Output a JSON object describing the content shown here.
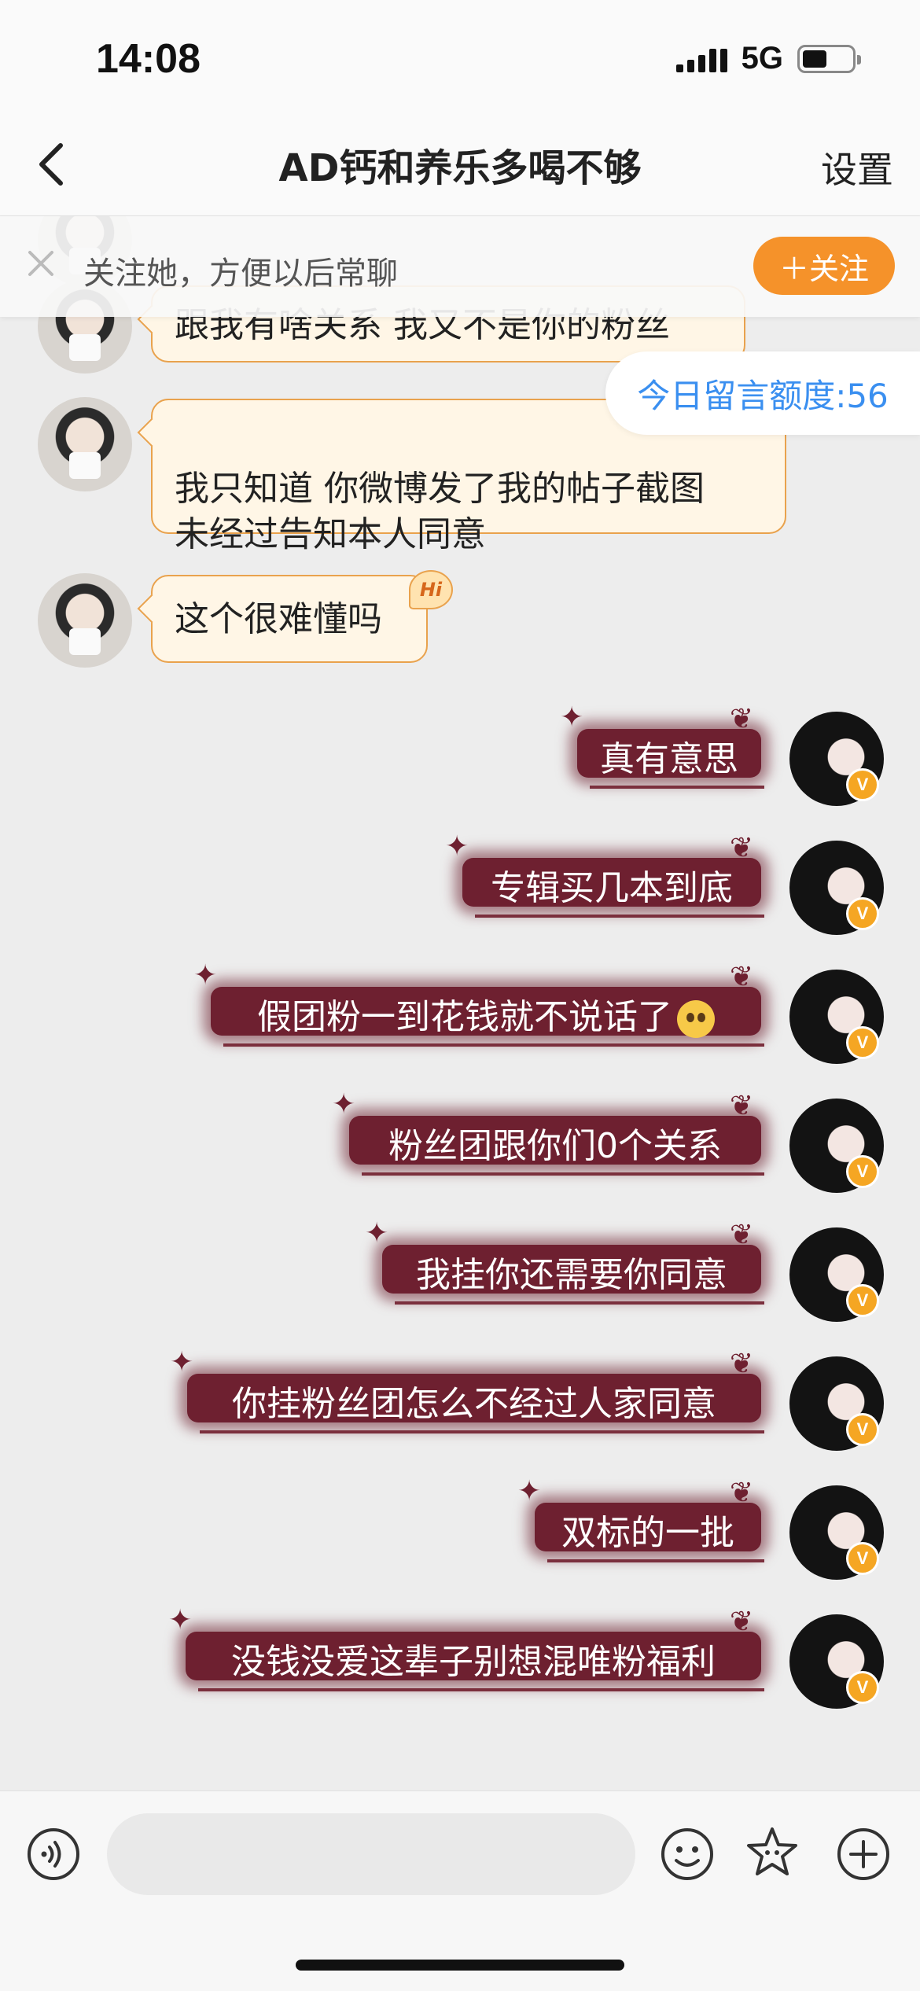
{
  "status_bar": {
    "time": "14:08",
    "network": "5G"
  },
  "nav": {
    "title": "AD钙和养乐多喝不够",
    "settings": "设置"
  },
  "banner": {
    "text": "关注她，方便以后常聊",
    "follow_button": "＋关注"
  },
  "quota": {
    "label": "今日留言额度:56"
  },
  "incoming": [
    {
      "text": "跟我有啥关系 我又不是你的粉丝"
    },
    {
      "text": "我只知道 你微博发了我的帖子截图\n未经过告知本人同意"
    },
    {
      "text": "这个很难懂吗"
    }
  ],
  "hi_badge": "Hi",
  "outgoing": [
    {
      "text": "真有意思"
    },
    {
      "text": "专辑买几本到底"
    },
    {
      "text": "假团粉一到花钱就不说话了"
    },
    {
      "text": "粉丝团跟你们0个关系"
    },
    {
      "text": "我挂你还需要你同意"
    },
    {
      "text": "你挂粉丝团怎么不经过人家同意"
    },
    {
      "text": "双标的一批"
    },
    {
      "text": "没钱没爱这辈子别想混唯粉福利"
    }
  ],
  "badges": {
    "verified": "V"
  },
  "icons": {
    "back": "chevron-left-icon",
    "close": "close-icon",
    "voice": "voice-icon",
    "emoji": "smiley-icon",
    "sticker": "star-face-icon",
    "add": "plus-circle-icon"
  },
  "colors": {
    "accent": "#f5922a",
    "quota_text": "#3a8ff0",
    "outgoing_bubble": "#6e2030",
    "incoming_border": "#e9a24d"
  }
}
